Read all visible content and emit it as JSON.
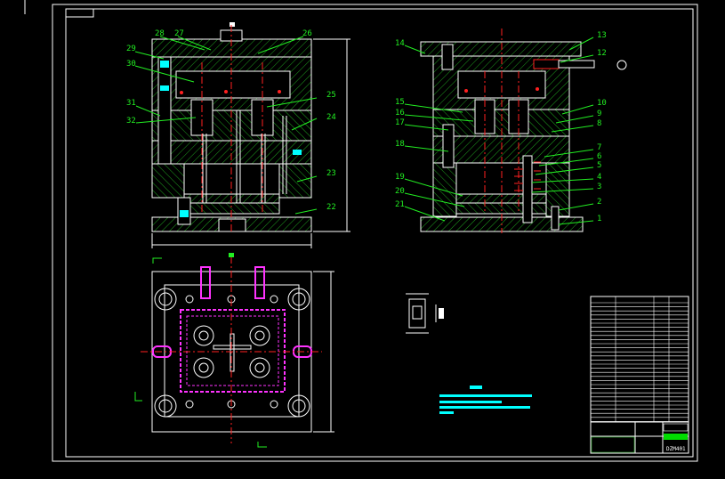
{
  "drawing": {
    "background": "#000000",
    "line_color": "#ffffff",
    "hatch_color": "#22cc22",
    "centerline_color": "#ff2020",
    "leader_color": "#22ee22",
    "part_color": "#ff33ff",
    "dim_color": "#00ffff",
    "front_view_labels": [
      "28",
      "27",
      "26",
      "29",
      "30",
      "25",
      "31",
      "24",
      "32",
      "23",
      "22"
    ],
    "side_view_labels": [
      "14",
      "13",
      "12",
      "15",
      "10",
      "16",
      "9",
      "17",
      "8",
      "18",
      "7",
      "6",
      "5",
      "19",
      "4",
      "20",
      "3",
      "21",
      "2",
      "1"
    ]
  },
  "title_block": {
    "drawing_no": "DZM401",
    "accent": "#00dd00"
  }
}
